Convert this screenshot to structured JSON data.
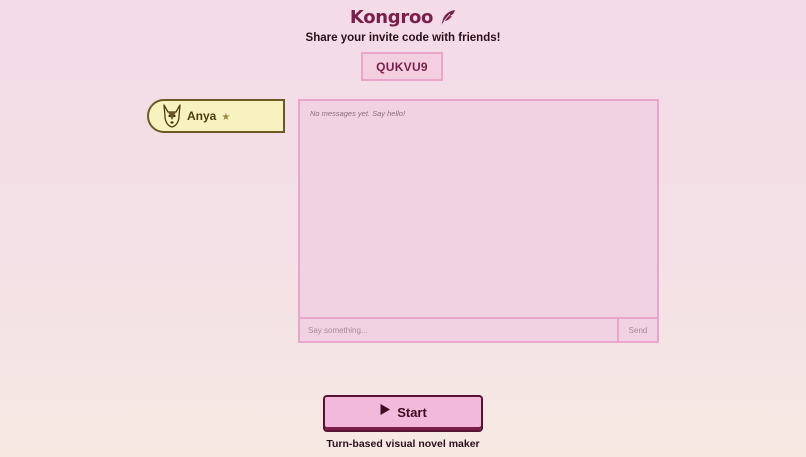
{
  "app": {
    "title": "Kongroo",
    "logo_icon": "quill-icon",
    "tagline": "Share your invite code with friends!",
    "footer": "Turn-based visual novel maker"
  },
  "invite": {
    "code": "QUKVU9"
  },
  "players": [
    {
      "name": "Anya",
      "avatar": "husky-avatar-icon",
      "badge": "★",
      "card_color": "#f7f2bf"
    }
  ],
  "chat": {
    "empty_message": "No messages yet. Say hello!",
    "input_placeholder": "Say something...",
    "input_value": "",
    "send_label": "Send"
  },
  "start": {
    "label": "Start",
    "icon": "play-icon"
  },
  "colors": {
    "brand": "#7a1e4c",
    "accent_border": "#eaa6ca",
    "panel_bg": "#f1d2e2",
    "button_bg": "#f2b9da"
  }
}
